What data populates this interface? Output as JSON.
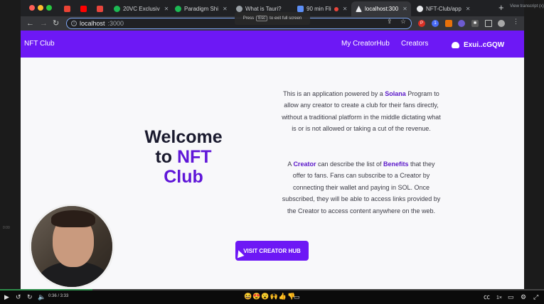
{
  "browser": {
    "tabs": [
      {
        "label": "",
        "icon": "gmail-icon",
        "color": "#ea4335"
      },
      {
        "label": "",
        "icon": "youtube-icon",
        "color": "#ff0000"
      },
      {
        "label": "",
        "icon": "app-icon",
        "color": "#e8453c"
      },
      {
        "label": "20VC Exclusiv",
        "icon": "spotify-icon",
        "color": "#1db954"
      },
      {
        "label": "Paradigm Shi",
        "icon": "spotify-icon",
        "color": "#1db954"
      },
      {
        "label": "What is Tauri?",
        "icon": "link-icon",
        "color": "#9aa0a6"
      },
      {
        "label": "90 min Fli",
        "icon": "image-icon",
        "color": "#5c8ef5"
      },
      {
        "label": "localhost:300",
        "icon": "vite-icon",
        "color": "#e8eaed",
        "active": true
      },
      {
        "label": "NFT-Club/app",
        "icon": "github-icon",
        "color": "#e8eaed"
      }
    ],
    "address": {
      "host": "localhost",
      "port": ":3000"
    },
    "fullscreen_hint": {
      "prefix": "Press",
      "key": "Esc",
      "suffix": "to exit full screen"
    },
    "view_transcript": "View transcript (x)"
  },
  "app": {
    "brand": "NFT Club",
    "nav": {
      "my_hub": "My CreatorHub",
      "creators": "Creators"
    },
    "wallet": "Exui..cGQW",
    "hero": {
      "line1": "Welcome",
      "line2a": "to ",
      "line2b": "NFT",
      "line3": "Club"
    },
    "para1": {
      "t1": "This is an application powered by a ",
      "b1": "Solana",
      "t2": " Program to allow any creator to create a club for their fans directly, without a traditional platform in the middle dictating what is or is not allowed or taking a cut of the revenue."
    },
    "para2": {
      "t1": "A ",
      "b1": "Creator",
      "t2": " can describe the list of ",
      "b2": "Benefits",
      "t3": " that they offer to fans. Fans can subscribe to a Creator by connecting their wallet and paying in SOL. Once subscribed, they will be able to access links provided by the Creator to access content anywhere on the web."
    },
    "cta": "VISIT CREATOR HUB"
  },
  "player": {
    "time": "0:36 / 3:33",
    "progress": 0.17,
    "reactions": "😆😍😮🙌👍👎",
    "speed": "1×",
    "side_label": "0:00"
  },
  "colors": {
    "accent": "#6d18f5",
    "accent_text": "#5f16d8"
  }
}
